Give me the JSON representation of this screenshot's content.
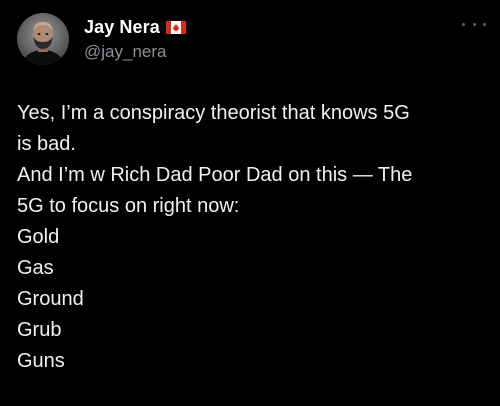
{
  "tweet": {
    "author": {
      "display_name": "Jay Nera",
      "handle": "@jay_nera",
      "flag_icon": "canada-flag-icon"
    },
    "more_icon": "more-horizontal-icon",
    "text_lines": [
      "Yes, I’m a conspiracy theorist that knows 5G",
      "is bad.",
      "And I’m w Rich Dad Poor Dad on this — The",
      "5G to focus on right now:",
      "Gold",
      "Gas",
      "Ground",
      "Grub",
      "Guns"
    ]
  },
  "colors": {
    "background": "#000000",
    "text": "#f1f1f1",
    "handle": "#8b8f94",
    "flag_red": "#d52b1e"
  }
}
